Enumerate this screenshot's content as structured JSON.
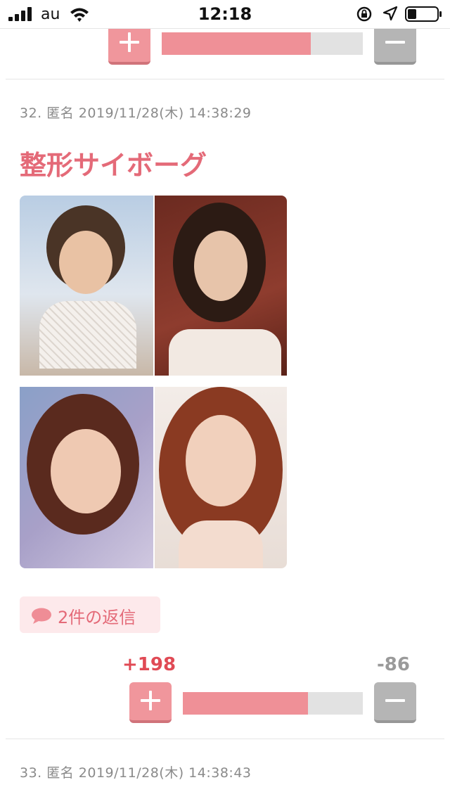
{
  "status_bar": {
    "carrier": "au",
    "time": "12:18"
  },
  "comments": [
    {
      "vote": {
        "fraction": 0.74
      }
    },
    {
      "meta": "32. 匿名 2019/11/28(木) 14:38:29",
      "body": "整形サイボーグ",
      "reply_label": "2件の返信",
      "vote": {
        "plus": "+198",
        "minus": "-86",
        "fraction": 0.697
      }
    },
    {
      "meta": "33. 匿名 2019/11/28(木) 14:38:43"
    }
  ],
  "colors": {
    "accent": "#e46a78",
    "plus": "#f0969c",
    "minus": "#b5b5b5"
  }
}
